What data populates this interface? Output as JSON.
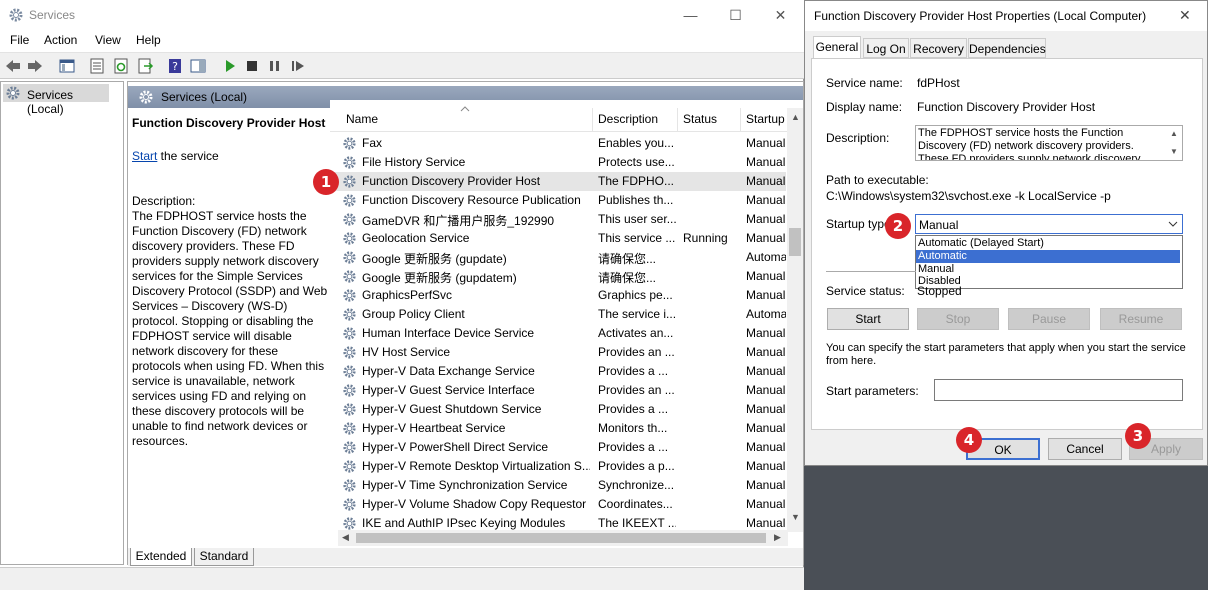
{
  "services_window": {
    "title": "Services",
    "menu": [
      "File",
      "Action",
      "View",
      "Help"
    ],
    "tree_root": "Services (Local)",
    "pane_header": "Services (Local)",
    "selected_service_title": "Function Discovery Provider Host",
    "start_link": "Start",
    "start_suffix": " the service",
    "description_label": "Description:",
    "description_text": "The FDPHOST service hosts the Function Discovery (FD) network discovery providers. These FD providers supply network discovery services for the Simple Services Discovery Protocol (SSDP) and Web Services – Discovery (WS-D) protocol. Stopping or disabling the FDPHOST service will disable network discovery for these protocols when using FD. When this service is unavailable, network services using FD and relying on these discovery protocols will be unable to find network devices or resources.",
    "columns": [
      "Name",
      "Description",
      "Status",
      "Startup"
    ],
    "rows": [
      {
        "name": "Fax",
        "desc": "Enables you...",
        "status": "",
        "startup": "Manual"
      },
      {
        "name": "File History Service",
        "desc": "Protects use...",
        "status": "",
        "startup": "Manual"
      },
      {
        "name": "Function Discovery Provider Host",
        "desc": "The FDPHO...",
        "status": "",
        "startup": "Manual"
      },
      {
        "name": "Function Discovery Resource Publication",
        "desc": "Publishes th...",
        "status": "",
        "startup": "Manual"
      },
      {
        "name": "GameDVR 和广播用户服务_192990",
        "desc": "This user ser...",
        "status": "",
        "startup": "Manual"
      },
      {
        "name": "Geolocation Service",
        "desc": "This service ...",
        "status": "Running",
        "startup": "Manual"
      },
      {
        "name": "Google 更新服务 (gupdate)",
        "desc": "请确保您...",
        "status": "",
        "startup": "Automa"
      },
      {
        "name": "Google 更新服务 (gupdatem)",
        "desc": "请确保您...",
        "status": "",
        "startup": "Manual"
      },
      {
        "name": "GraphicsPerfSvc",
        "desc": "Graphics pe...",
        "status": "",
        "startup": "Manual"
      },
      {
        "name": "Group Policy Client",
        "desc": "The service i...",
        "status": "",
        "startup": "Automa"
      },
      {
        "name": "Human Interface Device Service",
        "desc": "Activates an...",
        "status": "",
        "startup": "Manual"
      },
      {
        "name": "HV Host Service",
        "desc": "Provides an ...",
        "status": "",
        "startup": "Manual"
      },
      {
        "name": "Hyper-V Data Exchange Service",
        "desc": "Provides a ...",
        "status": "",
        "startup": "Manual"
      },
      {
        "name": "Hyper-V Guest Service Interface",
        "desc": "Provides an ...",
        "status": "",
        "startup": "Manual"
      },
      {
        "name": "Hyper-V Guest Shutdown Service",
        "desc": "Provides a ...",
        "status": "",
        "startup": "Manual"
      },
      {
        "name": "Hyper-V Heartbeat Service",
        "desc": "Monitors th...",
        "status": "",
        "startup": "Manual"
      },
      {
        "name": "Hyper-V PowerShell Direct Service",
        "desc": "Provides a ...",
        "status": "",
        "startup": "Manual"
      },
      {
        "name": "Hyper-V Remote Desktop Virtualization S...",
        "desc": "Provides a p...",
        "status": "",
        "startup": "Manual"
      },
      {
        "name": "Hyper-V Time Synchronization Service",
        "desc": "Synchronize...",
        "status": "",
        "startup": "Manual"
      },
      {
        "name": "Hyper-V Volume Shadow Copy Requestor",
        "desc": "Coordinates...",
        "status": "",
        "startup": "Manual"
      },
      {
        "name": "IKE and AuthIP IPsec Keying Modules",
        "desc": "The IKEEXT ...",
        "status": "",
        "startup": "Manual"
      }
    ],
    "tabs": [
      "Extended",
      "Standard"
    ]
  },
  "dialog": {
    "title": "Function Discovery Provider Host Properties (Local Computer)",
    "tabs": [
      "General",
      "Log On",
      "Recovery",
      "Dependencies"
    ],
    "service_name_label": "Service name:",
    "service_name": "fdPHost",
    "display_name_label": "Display name:",
    "display_name": "Function Discovery Provider Host",
    "description_label": "Description:",
    "description": "The FDPHOST service hosts the Function Discovery (FD) network discovery providers. These FD providers supply network discovery services for",
    "path_label": "Path to executable:",
    "path": "C:\\Windows\\system32\\svchost.exe -k LocalService -p",
    "startup_type_label": "Startup type:",
    "startup_type_value": "Manual",
    "startup_options": [
      "Automatic (Delayed Start)",
      "Automatic",
      "Manual",
      "Disabled"
    ],
    "service_status_label": "Service status:",
    "service_status": "Stopped",
    "buttons": {
      "start": "Start",
      "stop": "Stop",
      "pause": "Pause",
      "resume": "Resume"
    },
    "hint": "You can specify the start parameters that apply when you start the service from here.",
    "start_params_label": "Start parameters:",
    "ok": "OK",
    "cancel": "Cancel",
    "apply": "Apply"
  },
  "badges": [
    "1",
    "2",
    "3",
    "4"
  ],
  "colors": {
    "badge": "#d9252a",
    "selection": "#3c6fd1",
    "header": "#8796ae"
  }
}
